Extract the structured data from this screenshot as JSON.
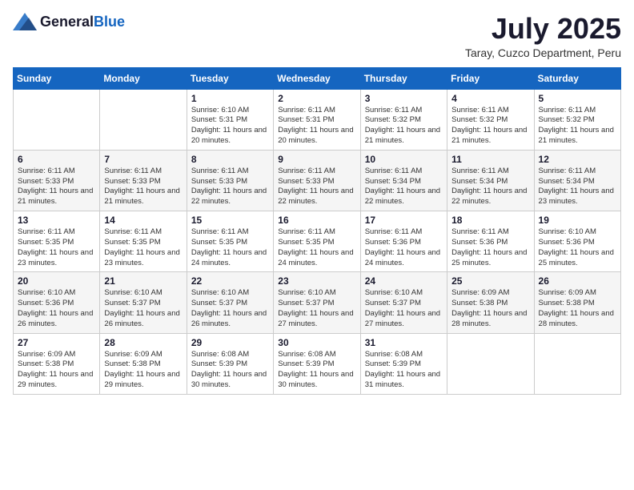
{
  "header": {
    "logo_general": "General",
    "logo_blue": "Blue",
    "month": "July 2025",
    "location": "Taray, Cuzco Department, Peru"
  },
  "weekdays": [
    "Sunday",
    "Monday",
    "Tuesday",
    "Wednesday",
    "Thursday",
    "Friday",
    "Saturday"
  ],
  "weeks": [
    [
      {
        "day": "",
        "info": ""
      },
      {
        "day": "",
        "info": ""
      },
      {
        "day": "1",
        "info": "Sunrise: 6:10 AM\nSunset: 5:31 PM\nDaylight: 11 hours and 20 minutes."
      },
      {
        "day": "2",
        "info": "Sunrise: 6:11 AM\nSunset: 5:31 PM\nDaylight: 11 hours and 20 minutes."
      },
      {
        "day": "3",
        "info": "Sunrise: 6:11 AM\nSunset: 5:32 PM\nDaylight: 11 hours and 21 minutes."
      },
      {
        "day": "4",
        "info": "Sunrise: 6:11 AM\nSunset: 5:32 PM\nDaylight: 11 hours and 21 minutes."
      },
      {
        "day": "5",
        "info": "Sunrise: 6:11 AM\nSunset: 5:32 PM\nDaylight: 11 hours and 21 minutes."
      }
    ],
    [
      {
        "day": "6",
        "info": "Sunrise: 6:11 AM\nSunset: 5:33 PM\nDaylight: 11 hours and 21 minutes."
      },
      {
        "day": "7",
        "info": "Sunrise: 6:11 AM\nSunset: 5:33 PM\nDaylight: 11 hours and 21 minutes."
      },
      {
        "day": "8",
        "info": "Sunrise: 6:11 AM\nSunset: 5:33 PM\nDaylight: 11 hours and 22 minutes."
      },
      {
        "day": "9",
        "info": "Sunrise: 6:11 AM\nSunset: 5:33 PM\nDaylight: 11 hours and 22 minutes."
      },
      {
        "day": "10",
        "info": "Sunrise: 6:11 AM\nSunset: 5:34 PM\nDaylight: 11 hours and 22 minutes."
      },
      {
        "day": "11",
        "info": "Sunrise: 6:11 AM\nSunset: 5:34 PM\nDaylight: 11 hours and 22 minutes."
      },
      {
        "day": "12",
        "info": "Sunrise: 6:11 AM\nSunset: 5:34 PM\nDaylight: 11 hours and 23 minutes."
      }
    ],
    [
      {
        "day": "13",
        "info": "Sunrise: 6:11 AM\nSunset: 5:35 PM\nDaylight: 11 hours and 23 minutes."
      },
      {
        "day": "14",
        "info": "Sunrise: 6:11 AM\nSunset: 5:35 PM\nDaylight: 11 hours and 23 minutes."
      },
      {
        "day": "15",
        "info": "Sunrise: 6:11 AM\nSunset: 5:35 PM\nDaylight: 11 hours and 24 minutes."
      },
      {
        "day": "16",
        "info": "Sunrise: 6:11 AM\nSunset: 5:35 PM\nDaylight: 11 hours and 24 minutes."
      },
      {
        "day": "17",
        "info": "Sunrise: 6:11 AM\nSunset: 5:36 PM\nDaylight: 11 hours and 24 minutes."
      },
      {
        "day": "18",
        "info": "Sunrise: 6:11 AM\nSunset: 5:36 PM\nDaylight: 11 hours and 25 minutes."
      },
      {
        "day": "19",
        "info": "Sunrise: 6:10 AM\nSunset: 5:36 PM\nDaylight: 11 hours and 25 minutes."
      }
    ],
    [
      {
        "day": "20",
        "info": "Sunrise: 6:10 AM\nSunset: 5:36 PM\nDaylight: 11 hours and 26 minutes."
      },
      {
        "day": "21",
        "info": "Sunrise: 6:10 AM\nSunset: 5:37 PM\nDaylight: 11 hours and 26 minutes."
      },
      {
        "day": "22",
        "info": "Sunrise: 6:10 AM\nSunset: 5:37 PM\nDaylight: 11 hours and 26 minutes."
      },
      {
        "day": "23",
        "info": "Sunrise: 6:10 AM\nSunset: 5:37 PM\nDaylight: 11 hours and 27 minutes."
      },
      {
        "day": "24",
        "info": "Sunrise: 6:10 AM\nSunset: 5:37 PM\nDaylight: 11 hours and 27 minutes."
      },
      {
        "day": "25",
        "info": "Sunrise: 6:09 AM\nSunset: 5:38 PM\nDaylight: 11 hours and 28 minutes."
      },
      {
        "day": "26",
        "info": "Sunrise: 6:09 AM\nSunset: 5:38 PM\nDaylight: 11 hours and 28 minutes."
      }
    ],
    [
      {
        "day": "27",
        "info": "Sunrise: 6:09 AM\nSunset: 5:38 PM\nDaylight: 11 hours and 29 minutes."
      },
      {
        "day": "28",
        "info": "Sunrise: 6:09 AM\nSunset: 5:38 PM\nDaylight: 11 hours and 29 minutes."
      },
      {
        "day": "29",
        "info": "Sunrise: 6:08 AM\nSunset: 5:39 PM\nDaylight: 11 hours and 30 minutes."
      },
      {
        "day": "30",
        "info": "Sunrise: 6:08 AM\nSunset: 5:39 PM\nDaylight: 11 hours and 30 minutes."
      },
      {
        "day": "31",
        "info": "Sunrise: 6:08 AM\nSunset: 5:39 PM\nDaylight: 11 hours and 31 minutes."
      },
      {
        "day": "",
        "info": ""
      },
      {
        "day": "",
        "info": ""
      }
    ]
  ]
}
